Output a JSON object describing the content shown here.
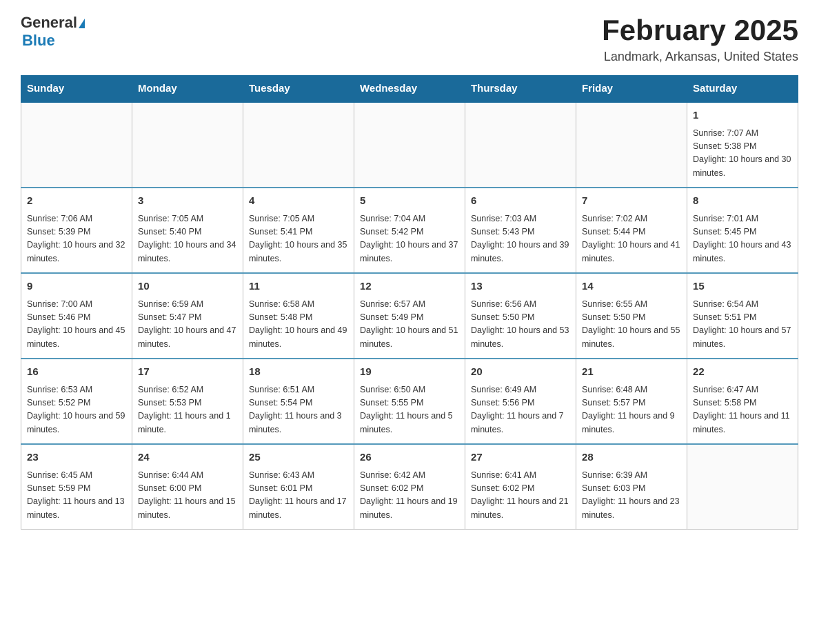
{
  "header": {
    "logo_general": "General",
    "logo_blue": "Blue",
    "month_title": "February 2025",
    "location": "Landmark, Arkansas, United States"
  },
  "days_of_week": [
    "Sunday",
    "Monday",
    "Tuesday",
    "Wednesday",
    "Thursday",
    "Friday",
    "Saturday"
  ],
  "weeks": [
    [
      {
        "day": "",
        "info": ""
      },
      {
        "day": "",
        "info": ""
      },
      {
        "day": "",
        "info": ""
      },
      {
        "day": "",
        "info": ""
      },
      {
        "day": "",
        "info": ""
      },
      {
        "day": "",
        "info": ""
      },
      {
        "day": "1",
        "info": "Sunrise: 7:07 AM\nSunset: 5:38 PM\nDaylight: 10 hours and 30 minutes."
      }
    ],
    [
      {
        "day": "2",
        "info": "Sunrise: 7:06 AM\nSunset: 5:39 PM\nDaylight: 10 hours and 32 minutes."
      },
      {
        "day": "3",
        "info": "Sunrise: 7:05 AM\nSunset: 5:40 PM\nDaylight: 10 hours and 34 minutes."
      },
      {
        "day": "4",
        "info": "Sunrise: 7:05 AM\nSunset: 5:41 PM\nDaylight: 10 hours and 35 minutes."
      },
      {
        "day": "5",
        "info": "Sunrise: 7:04 AM\nSunset: 5:42 PM\nDaylight: 10 hours and 37 minutes."
      },
      {
        "day": "6",
        "info": "Sunrise: 7:03 AM\nSunset: 5:43 PM\nDaylight: 10 hours and 39 minutes."
      },
      {
        "day": "7",
        "info": "Sunrise: 7:02 AM\nSunset: 5:44 PM\nDaylight: 10 hours and 41 minutes."
      },
      {
        "day": "8",
        "info": "Sunrise: 7:01 AM\nSunset: 5:45 PM\nDaylight: 10 hours and 43 minutes."
      }
    ],
    [
      {
        "day": "9",
        "info": "Sunrise: 7:00 AM\nSunset: 5:46 PM\nDaylight: 10 hours and 45 minutes."
      },
      {
        "day": "10",
        "info": "Sunrise: 6:59 AM\nSunset: 5:47 PM\nDaylight: 10 hours and 47 minutes."
      },
      {
        "day": "11",
        "info": "Sunrise: 6:58 AM\nSunset: 5:48 PM\nDaylight: 10 hours and 49 minutes."
      },
      {
        "day": "12",
        "info": "Sunrise: 6:57 AM\nSunset: 5:49 PM\nDaylight: 10 hours and 51 minutes."
      },
      {
        "day": "13",
        "info": "Sunrise: 6:56 AM\nSunset: 5:50 PM\nDaylight: 10 hours and 53 minutes."
      },
      {
        "day": "14",
        "info": "Sunrise: 6:55 AM\nSunset: 5:50 PM\nDaylight: 10 hours and 55 minutes."
      },
      {
        "day": "15",
        "info": "Sunrise: 6:54 AM\nSunset: 5:51 PM\nDaylight: 10 hours and 57 minutes."
      }
    ],
    [
      {
        "day": "16",
        "info": "Sunrise: 6:53 AM\nSunset: 5:52 PM\nDaylight: 10 hours and 59 minutes."
      },
      {
        "day": "17",
        "info": "Sunrise: 6:52 AM\nSunset: 5:53 PM\nDaylight: 11 hours and 1 minute."
      },
      {
        "day": "18",
        "info": "Sunrise: 6:51 AM\nSunset: 5:54 PM\nDaylight: 11 hours and 3 minutes."
      },
      {
        "day": "19",
        "info": "Sunrise: 6:50 AM\nSunset: 5:55 PM\nDaylight: 11 hours and 5 minutes."
      },
      {
        "day": "20",
        "info": "Sunrise: 6:49 AM\nSunset: 5:56 PM\nDaylight: 11 hours and 7 minutes."
      },
      {
        "day": "21",
        "info": "Sunrise: 6:48 AM\nSunset: 5:57 PM\nDaylight: 11 hours and 9 minutes."
      },
      {
        "day": "22",
        "info": "Sunrise: 6:47 AM\nSunset: 5:58 PM\nDaylight: 11 hours and 11 minutes."
      }
    ],
    [
      {
        "day": "23",
        "info": "Sunrise: 6:45 AM\nSunset: 5:59 PM\nDaylight: 11 hours and 13 minutes."
      },
      {
        "day": "24",
        "info": "Sunrise: 6:44 AM\nSunset: 6:00 PM\nDaylight: 11 hours and 15 minutes."
      },
      {
        "day": "25",
        "info": "Sunrise: 6:43 AM\nSunset: 6:01 PM\nDaylight: 11 hours and 17 minutes."
      },
      {
        "day": "26",
        "info": "Sunrise: 6:42 AM\nSunset: 6:02 PM\nDaylight: 11 hours and 19 minutes."
      },
      {
        "day": "27",
        "info": "Sunrise: 6:41 AM\nSunset: 6:02 PM\nDaylight: 11 hours and 21 minutes."
      },
      {
        "day": "28",
        "info": "Sunrise: 6:39 AM\nSunset: 6:03 PM\nDaylight: 11 hours and 23 minutes."
      },
      {
        "day": "",
        "info": ""
      }
    ]
  ]
}
